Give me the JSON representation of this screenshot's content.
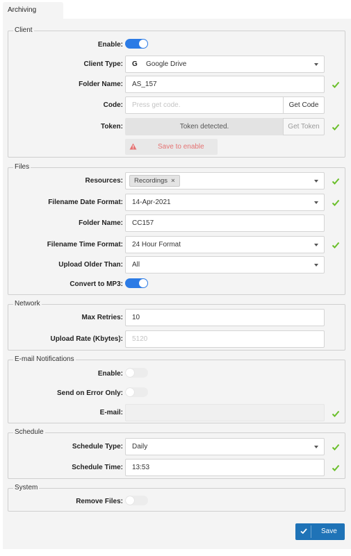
{
  "tab": {
    "label": "Archiving"
  },
  "client": {
    "legend": "Client",
    "enable_label": "Enable:",
    "enable_on": true,
    "client_type_label": "Client Type:",
    "client_type_value": "Google Drive",
    "client_type_icon": "google-g-icon",
    "folder_name_label": "Folder Name:",
    "folder_name_value": "AS_157",
    "code_label": "Code:",
    "code_placeholder": "Press get code.",
    "get_code_button": "Get Code",
    "token_label": "Token:",
    "token_status": "Token detected.",
    "get_token_button": "Get Token",
    "save_to_enable": "Save to enable"
  },
  "files": {
    "legend": "Files",
    "resources_label": "Resources:",
    "resources_tags": [
      "Recordings"
    ],
    "date_format_label": "Filename Date Format:",
    "date_format_value": "14-Apr-2021",
    "folder_name_label": "Folder Name:",
    "folder_name_value": "CC157",
    "time_format_label": "Filename Time Format:",
    "time_format_value": "24 Hour Format",
    "upload_older_label": "Upload Older Than:",
    "upload_older_value": "All",
    "convert_mp3_label": "Convert to MP3:",
    "convert_mp3_on": true
  },
  "network": {
    "legend": "Network",
    "max_retries_label": "Max Retries:",
    "max_retries_value": "10",
    "upload_rate_label": "Upload Rate (Kbytes):",
    "upload_rate_placeholder": "5120"
  },
  "email": {
    "legend": "E-mail Notifications",
    "enable_label": "Enable:",
    "enable_on": false,
    "error_only_label": "Send on Error Only:",
    "error_only_on": false,
    "email_label": "E-mail:",
    "email_value": ""
  },
  "schedule": {
    "legend": "Schedule",
    "type_label": "Schedule Type:",
    "type_value": "Daily",
    "time_label": "Schedule Time:",
    "time_value": "13:53"
  },
  "system": {
    "legend": "System",
    "remove_files_label": "Remove Files:",
    "remove_files_on": false
  },
  "footer": {
    "save_button": "Save"
  },
  "colors": {
    "accent": "#2c7be5",
    "success": "#6abf2a",
    "warning": "#e57373",
    "button": "#1f73b7"
  }
}
